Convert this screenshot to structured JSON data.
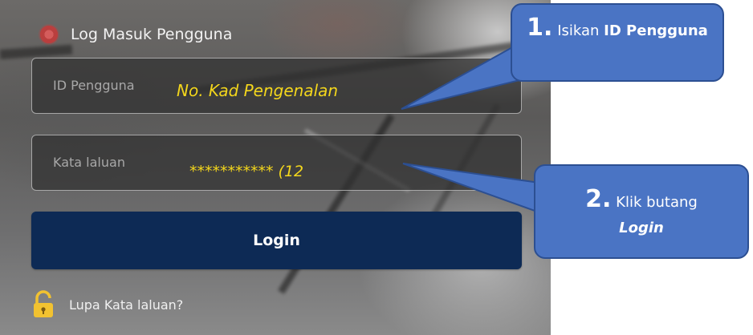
{
  "header": {
    "title": "Log Masuk Pengguna",
    "icon": "brand-logo-icon"
  },
  "form": {
    "id_field": {
      "label": "ID Pengguna",
      "value": "No. Kad Pengenalan"
    },
    "password_field": {
      "label": "Kata laluan",
      "value": "*********** (12"
    },
    "login_label": "Login",
    "forgot_label": "Lupa Kata laluan?",
    "forgot_icon": "unlock-icon"
  },
  "callouts": {
    "step1": {
      "number": "1.",
      "text_plain": "Isikan",
      "text_bold": "ID Pengguna"
    },
    "step2": {
      "number": "2.",
      "text_plain": "Klik butang",
      "text_bold_italic": "Login"
    }
  },
  "colors": {
    "callout_fill": "#4a74c4",
    "callout_border": "#2c4f92",
    "login_button": "#0d2a55",
    "annotation_text": "#f3d61c",
    "lock_icon": "#f2c230"
  }
}
